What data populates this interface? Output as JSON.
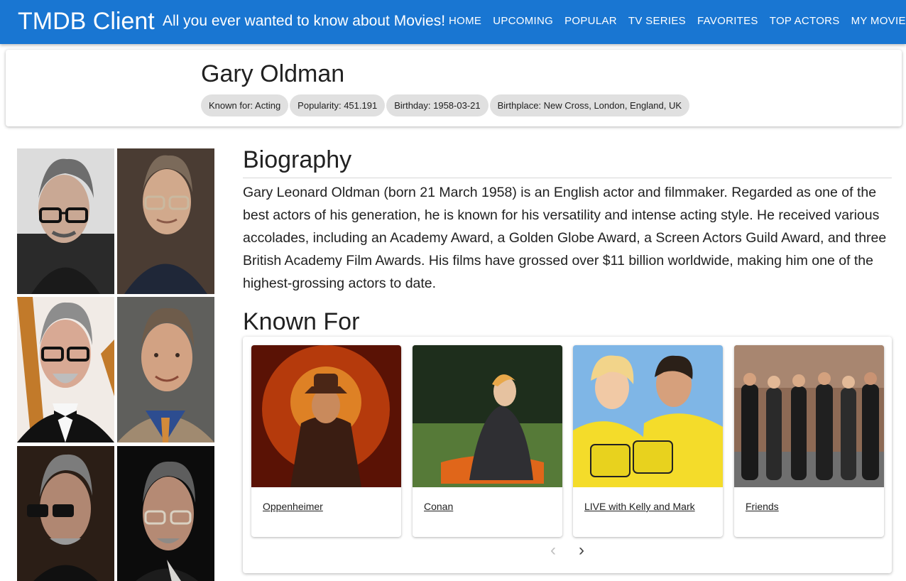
{
  "appbar": {
    "brand": "TMDB Client",
    "tagline": "All you ever wanted to know about Movies!",
    "nav": [
      "HOME",
      "UPCOMING",
      "POPULAR",
      "TV SERIES",
      "FAVORITES",
      "TOP ACTORS",
      "MY MOVIES"
    ],
    "color": "#1976d2"
  },
  "person": {
    "name": "Gary Oldman",
    "chips": {
      "known_for": "Known for: Acting",
      "popularity": "Popularity: 451.191",
      "birthday": "Birthday: 1958-03-21",
      "birthplace": "Birthplace: New Cross, London, England, UK"
    }
  },
  "biography": {
    "title": "Biography",
    "text": "Gary Leonard Oldman (born 21 March 1958) is an English actor and filmmaker. Regarded as one of the best actors of his generation, he is known for his versatility and intense acting style. He received various accolades, including an Academy Award, a Golden Globe Award, a Screen Actors Guild Award, and three British Academy Film Awards. His films have grossed over $11 billion worldwide, making him one of the highest-grossing actors to date."
  },
  "known_for": {
    "title": "Known For",
    "items": [
      {
        "title": "Oppenheimer"
      },
      {
        "title": "Conan"
      },
      {
        "title": "LIVE with Kelly and Mark"
      },
      {
        "title": "Friends"
      }
    ],
    "prev_icon": "chevron-left-icon",
    "next_icon": "chevron-right-icon"
  }
}
